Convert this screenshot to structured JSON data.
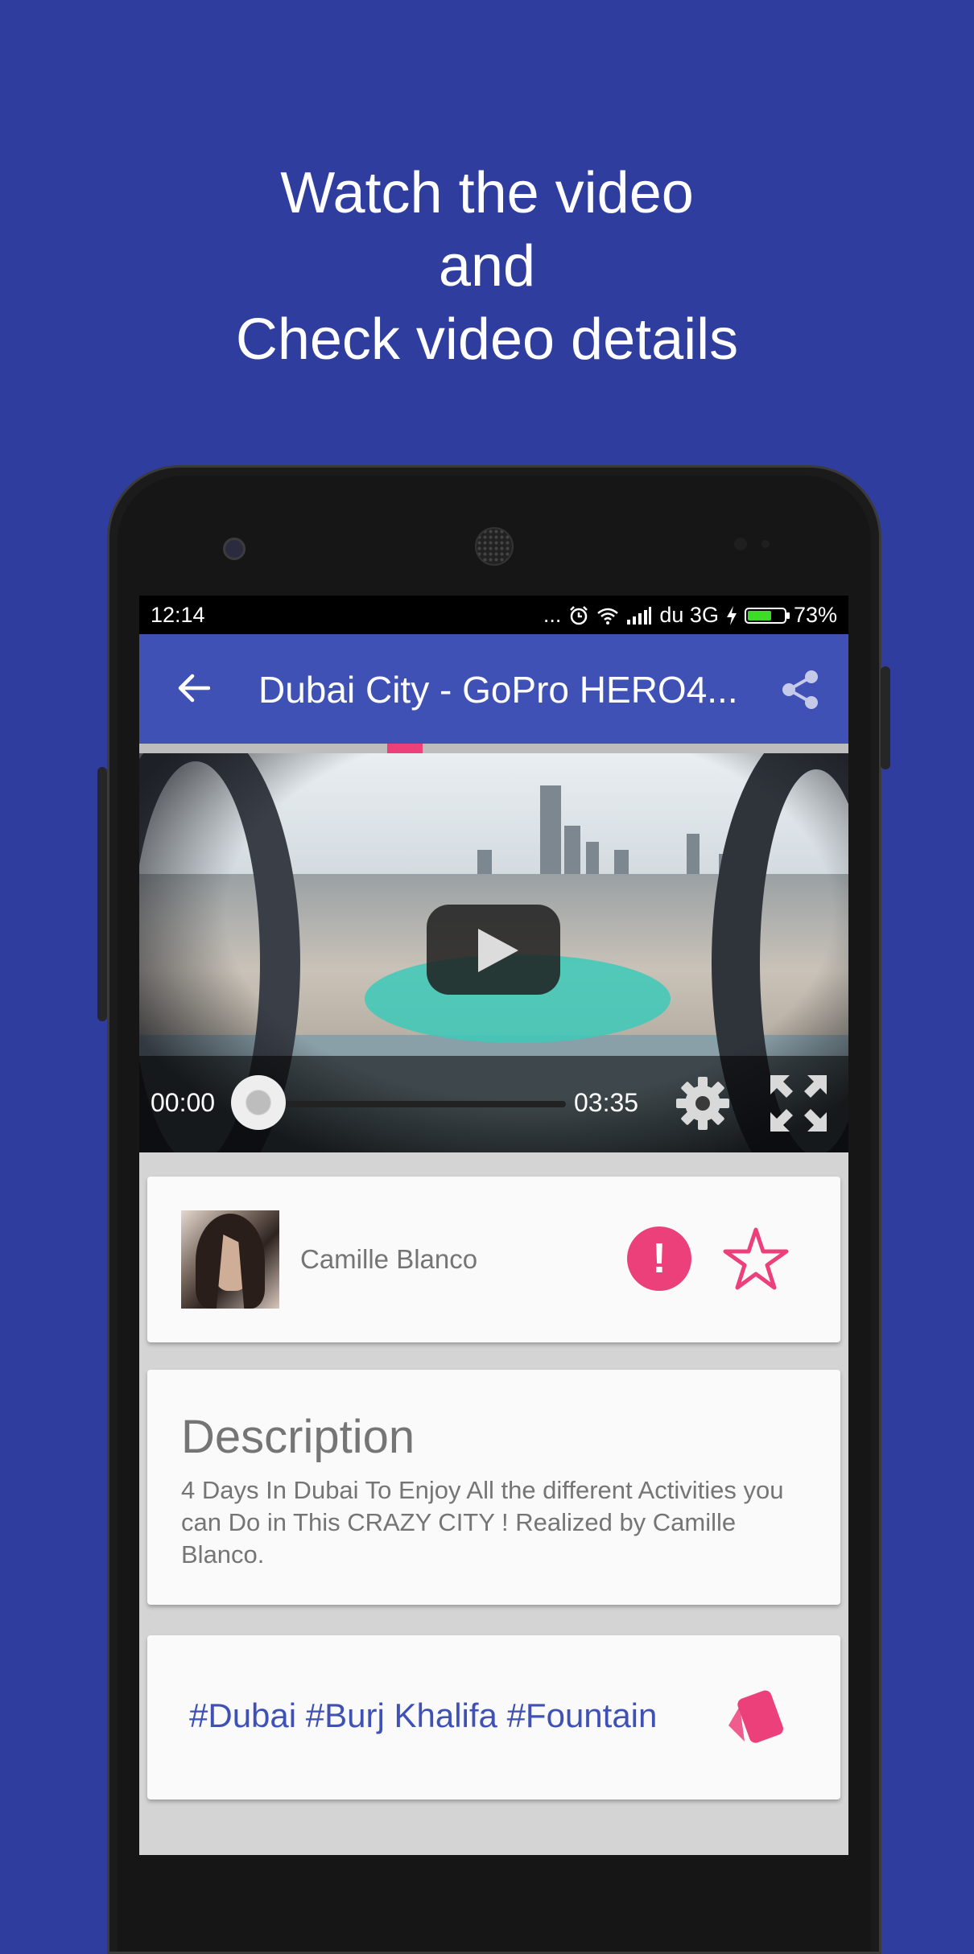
{
  "promo": {
    "line1": "Watch the video",
    "line2": "and",
    "line3": "Check video details"
  },
  "status_bar": {
    "time": "12:14",
    "dots": "...",
    "carrier": "du 3G",
    "battery": "73%",
    "battery_level": 0.73
  },
  "app_bar": {
    "title": "Dubai City - GoPro HERO4...",
    "back_icon": "arrow-back-icon",
    "share_icon": "share-icon"
  },
  "player": {
    "current_time": "00:00",
    "duration": "03:35",
    "progress": 0.0
  },
  "author": {
    "name": "Camille Blanco",
    "report_label": "!"
  },
  "description": {
    "title": "Description",
    "text": "4 Days In Dubai To Enjoy All the different Activities you can Do in This CRAZY CITY ! Realized by Camille Blanco."
  },
  "tags": {
    "text": "#Dubai #Burj Khalifa #Fountain"
  },
  "colors": {
    "background": "#2f3e9e",
    "app_bar": "#3f51b5",
    "accent": "#ec407a"
  }
}
